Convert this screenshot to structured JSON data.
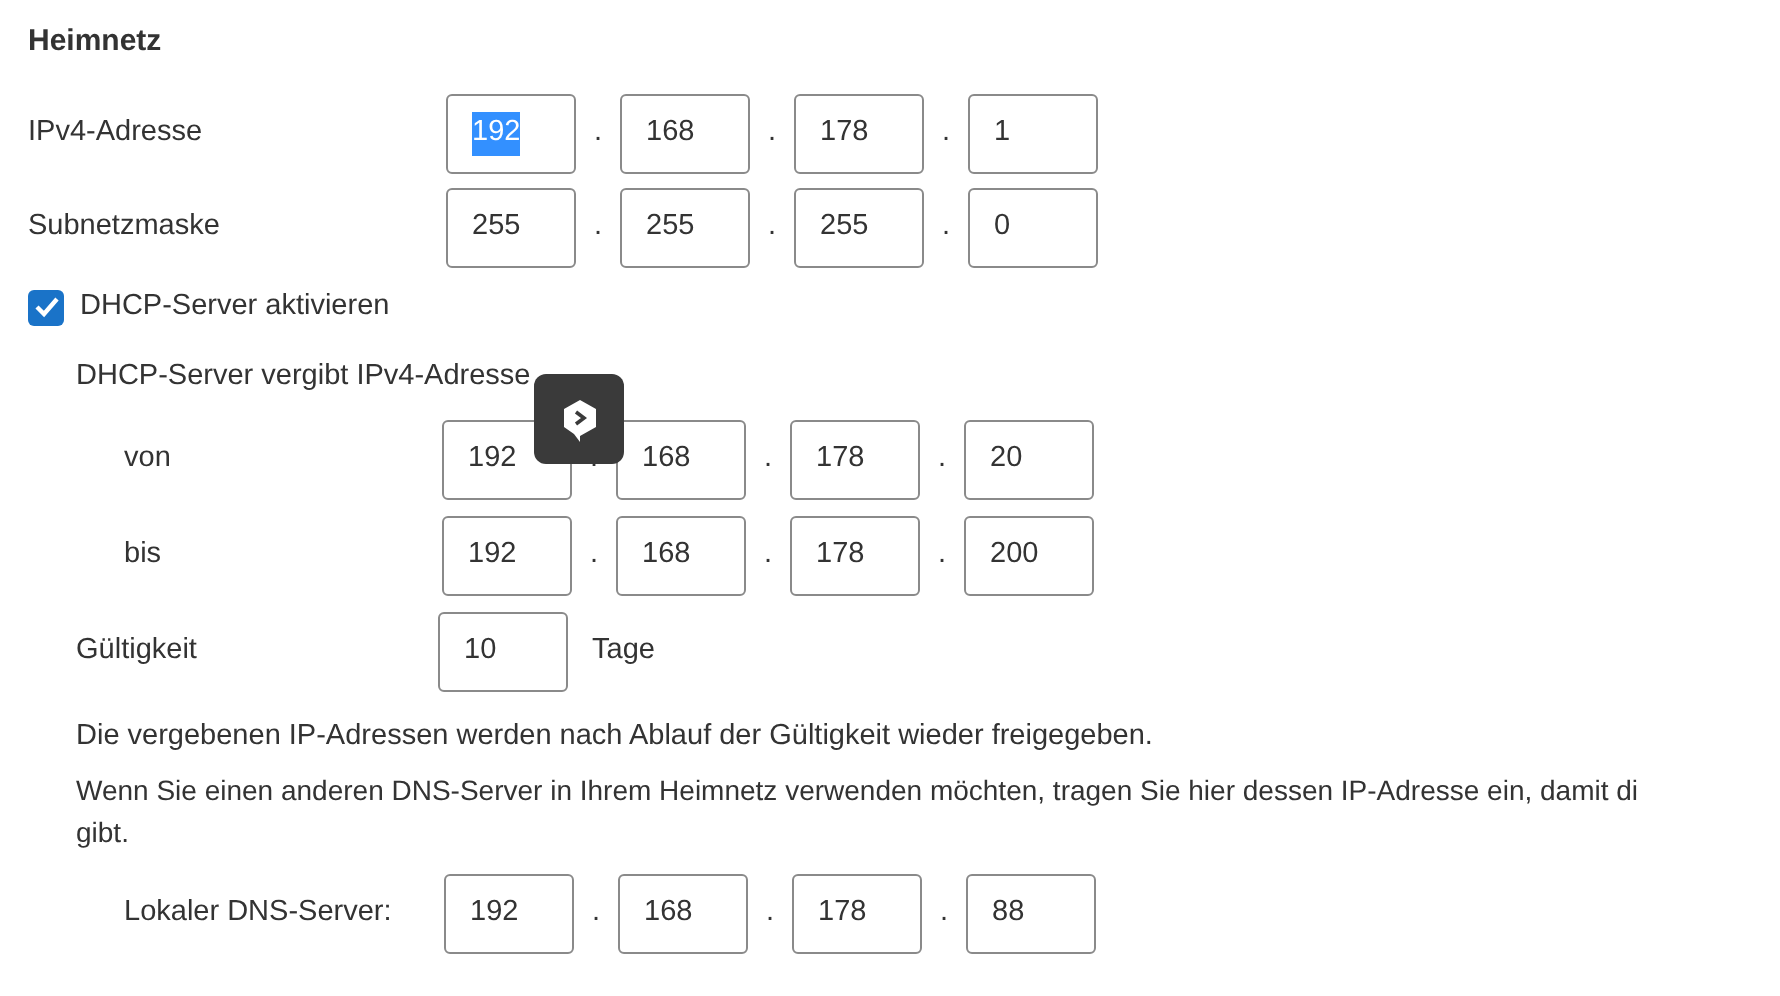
{
  "heading": "Heimnetz",
  "ipv4": {
    "label": "IPv4-Adresse",
    "octets": [
      {
        "value": "192",
        "text_selected": true
      },
      {
        "value": "168",
        "text_selected": false
      },
      {
        "value": "178",
        "text_selected": false
      },
      {
        "value": "1",
        "text_selected": false
      }
    ],
    "separator": "."
  },
  "subnet": {
    "label": "Subnetzmaske",
    "octets": [
      {
        "value": "255",
        "text_selected": false
      },
      {
        "value": "255",
        "text_selected": false
      },
      {
        "value": "255",
        "text_selected": false
      },
      {
        "value": "0",
        "text_selected": false
      }
    ],
    "separator": "."
  },
  "dhcp": {
    "label": "DHCP-Server aktivieren",
    "checked": true,
    "range_caption": "DHCP-Server vergibt IPv4-Adresse",
    "from": {
      "label": "von",
      "octets": [
        {
          "value": "192",
          "text_selected": false
        },
        {
          "value": "168",
          "text_selected": false
        },
        {
          "value": "178",
          "text_selected": false
        },
        {
          "value": "20",
          "text_selected": false
        }
      ],
      "separator": "."
    },
    "to": {
      "label": "bis",
      "octets": [
        {
          "value": "192",
          "text_selected": false
        },
        {
          "value": "168",
          "text_selected": false
        },
        {
          "value": "178",
          "text_selected": false
        },
        {
          "value": "200",
          "text_selected": false
        }
      ],
      "separator": "."
    },
    "validity": {
      "label": "Gültigkeit",
      "value": "10",
      "unit": "Tage"
    },
    "note": "Die vergebenen IP-Adressen werden nach Ablauf der Gültigkeit wieder freigegeben.",
    "dns_note_lines": [
      "Wenn Sie einen anderen DNS-Server in Ihrem Heimnetz verwenden möchten, tragen Sie hier dessen IP-Adresse ein, damit di",
      "gibt."
    ],
    "dns": {
      "label": "Lokaler DNS-Server:",
      "octets": [
        {
          "value": "192",
          "text_selected": false
        },
        {
          "value": "168",
          "text_selected": false
        },
        {
          "value": "178",
          "text_selected": false
        },
        {
          "value": "88",
          "text_selected": false
        }
      ],
      "separator": "."
    }
  }
}
